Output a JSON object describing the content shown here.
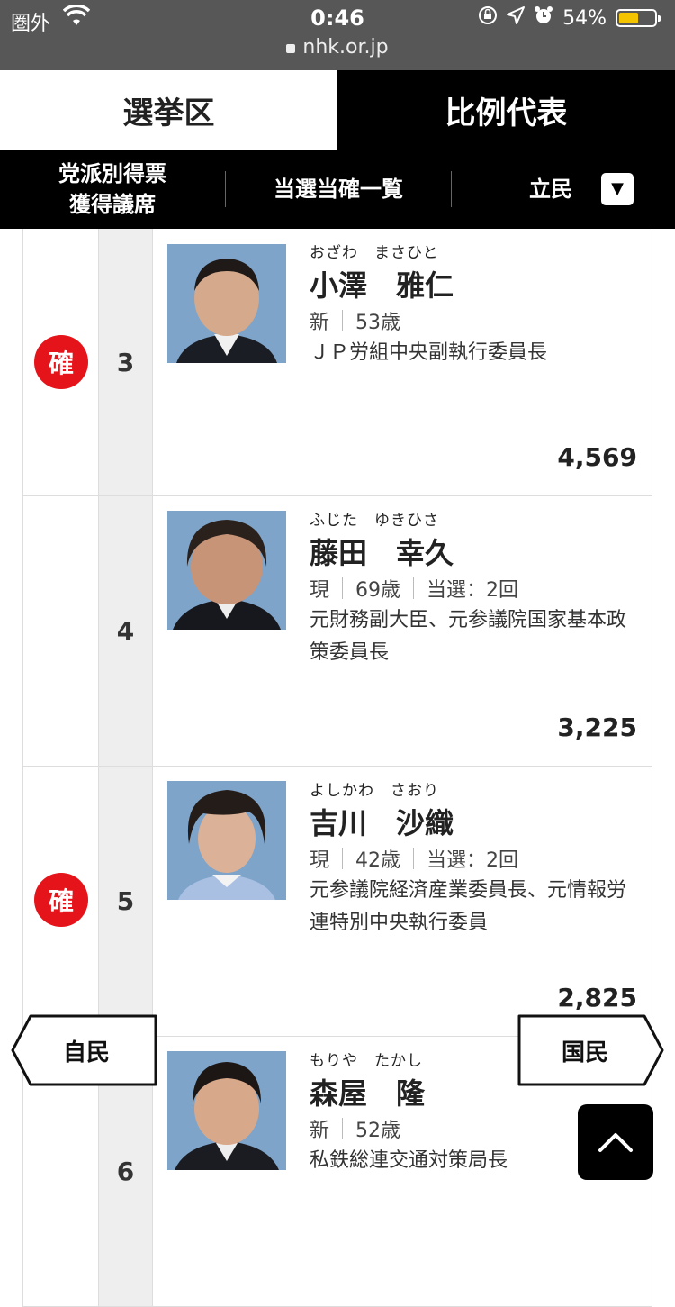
{
  "status_bar": {
    "carrier": "圏外",
    "time": "0:46",
    "url": "nhk.or.jp",
    "battery": "54%",
    "battery_level": 0.54
  },
  "tabs": [
    {
      "label": "選挙区",
      "active": false
    },
    {
      "label": "比例代表",
      "active": true
    }
  ],
  "subnav": {
    "item1_line1": "党派別得票",
    "item1_line2": "獲得議席",
    "item2": "当選当確一覧",
    "party": "立民",
    "dropdown_icon": "▼"
  },
  "candidates": [
    {
      "rank": "3",
      "badge": "確",
      "kana": "おざわ　まさひと",
      "name": "小澤　雅仁",
      "status": "新",
      "age": "53歳",
      "terms": "",
      "career": "ＪＰ労組中央副執行委員長",
      "votes": "4,569"
    },
    {
      "rank": "4",
      "badge": "",
      "kana": "ふじた　ゆきひさ",
      "name": "藤田　幸久",
      "status": "現",
      "age": "69歳",
      "terms": "当選：2回",
      "career": "元財務副大臣、元参議院国家基本政策委員長",
      "votes": "3,225"
    },
    {
      "rank": "5",
      "badge": "確",
      "kana": "よしかわ　さおり",
      "name": "吉川　沙織",
      "status": "現",
      "age": "42歳",
      "terms": "当選：2回",
      "career": "元参議院経済産業委員長、元情報労連特別中央執行委員",
      "votes": "2,825"
    },
    {
      "rank": "6",
      "badge": "",
      "kana": "もりや　たかし",
      "name": "森屋　隆",
      "status": "新",
      "age": "52歳",
      "terms": "",
      "career": "私鉄総連交通対策局長",
      "votes": ""
    }
  ],
  "nav": {
    "prev_label": "自民",
    "next_label": "国民",
    "top_icon": "chevron-up-icon"
  },
  "colors": {
    "badge_red": "#e5141a",
    "status_bar": "#575757",
    "active_tab": "#000000"
  }
}
